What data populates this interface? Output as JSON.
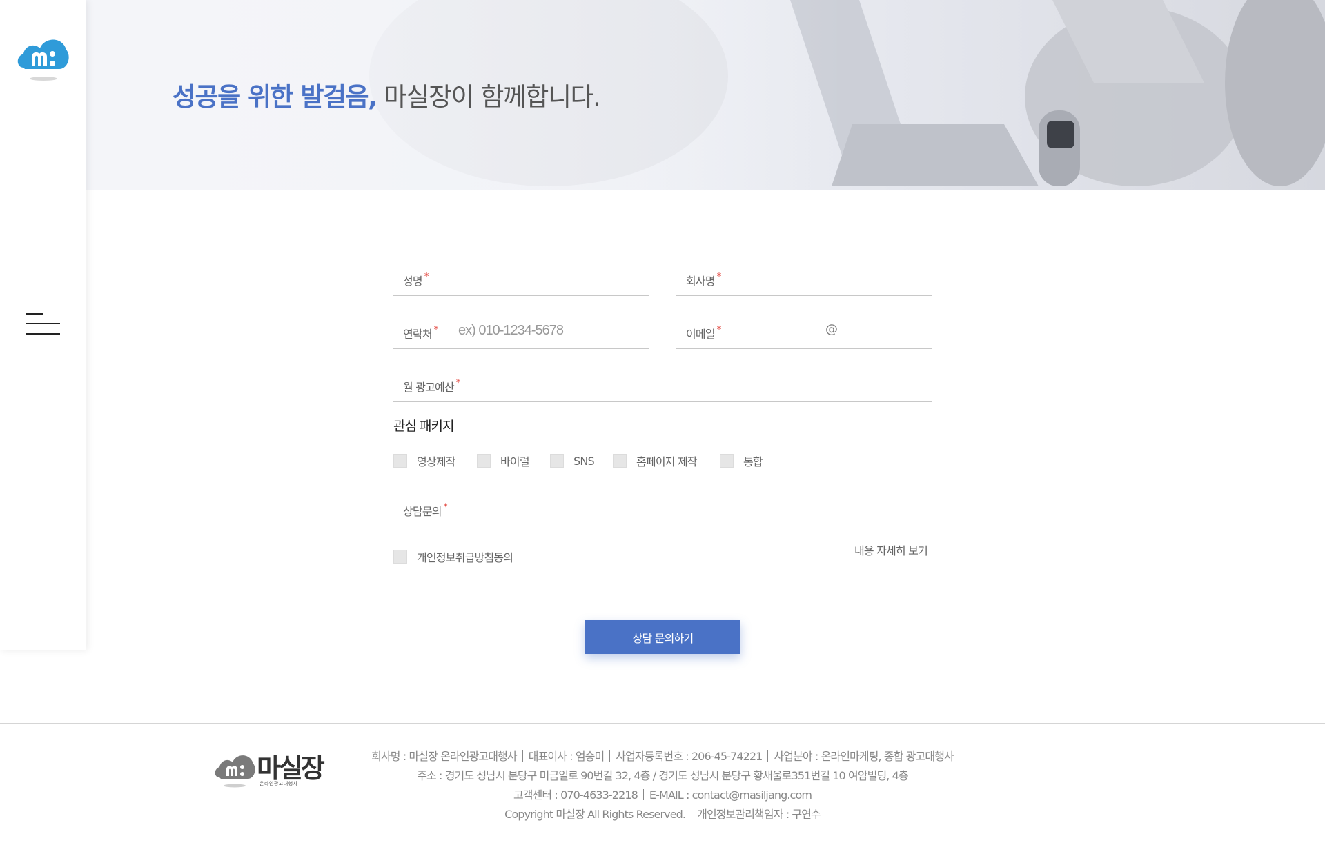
{
  "hero": {
    "title_highlight": "성공을 위한 발걸음,",
    "title_rest": " 마실장이 함께합니다."
  },
  "form": {
    "name_label": "성명",
    "company_label": "회사명",
    "phone_label": "연락처",
    "phone_placeholder": "ex) 010-1234-5678",
    "email_label": "이메일",
    "email_at": "@",
    "budget_label": "월 광고예산",
    "required_mark": "*",
    "package_title": "관심 패키지",
    "packages": [
      "영상제작",
      "바이럴",
      "SNS",
      "홈페이지 제작",
      "통합"
    ],
    "inquiry_label": "상담문의",
    "privacy_label": "개인정보취급방침동의",
    "privacy_detail": "내용 자세히 보기",
    "submit_label": "상담 문의하기"
  },
  "footer": {
    "logo_text": "마실장",
    "logo_sub": "온라인광고대행사",
    "line1": [
      "회사명 : 마실장 온라인광고대행사",
      "대표이사 : 엄승미",
      "사업자등록번호 : 206-45-74221",
      "사업분야 : 온라인마케팅, 종합 광고대행사"
    ],
    "line2": "주소 : 경기도 성남시 분당구 미금일로 90번길 32, 4층 / 경기도 성남시 분당구 황새울로351번길 10 여암빌딩, 4층",
    "line3": [
      "고객센터 : 070-4633-2218",
      "E-MAIL : contact@masiljang.com"
    ],
    "line4": [
      "Copyright 마실장 All Rights Reserved.",
      "개인정보관리책임자 : 구연수"
    ]
  },
  "colors": {
    "accent": "#4a72c6",
    "required": "#e0342b"
  }
}
